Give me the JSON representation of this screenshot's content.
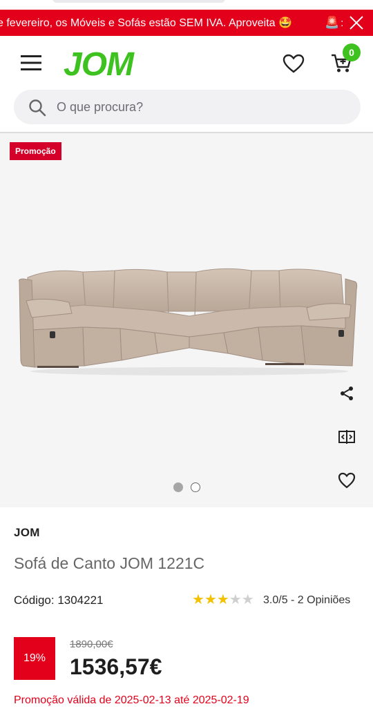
{
  "promo_banner": {
    "text": "e fevereiro, os Móveis e Sofás estão SEM IVA. Aproveita 🤩",
    "trailing_glyph": "🚨",
    "trailing_text": ":"
  },
  "header": {
    "logo": "JOM",
    "cart_count": "0"
  },
  "search": {
    "placeholder": "O que procura?"
  },
  "gallery": {
    "badge": "Promoção",
    "slides_total": 2,
    "current_slide": 1
  },
  "product": {
    "brand": "JOM",
    "title": "Sofá de Canto JOM 1221C",
    "code_label": "Código: 1304221",
    "rating_value": 3,
    "rating_max": 5,
    "rating_text": "3.0/5 - 2 Opiniões",
    "discount": "19%",
    "old_price": "1890,00€",
    "new_price": "1536,57€",
    "validity": "Promoção válida de 2025-02-13 até 2025-02-19"
  },
  "colors": {
    "accent_red": "#e3001b",
    "brand_green": "#3ec220",
    "star_filled": "#f2c200",
    "star_empty": "#cfcfcf",
    "sofa_fabric": "#c9b8a9"
  },
  "icons": [
    "menu-icon",
    "heart-icon",
    "cart-icon",
    "search-icon",
    "close-icon",
    "share-icon",
    "compare-icon",
    "heart-outline-icon",
    "star-icon"
  ]
}
